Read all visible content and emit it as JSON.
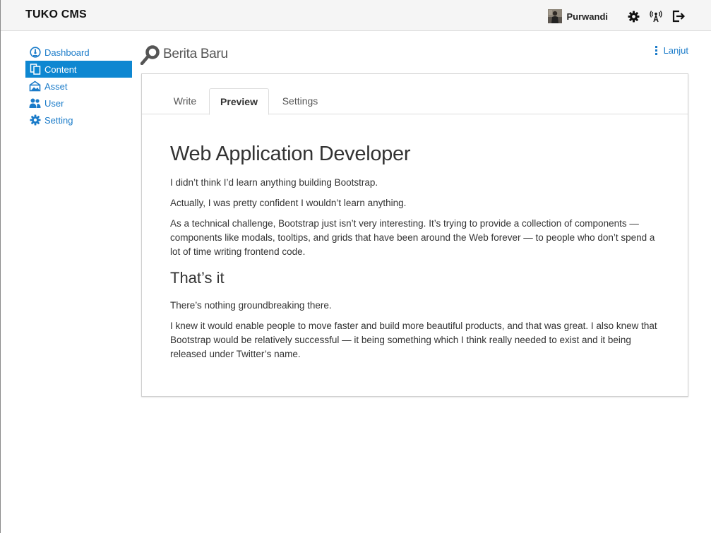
{
  "navbar": {
    "brand": "TUKO CMS",
    "user_name": "Purwandi",
    "icons": [
      "avatar",
      "gear-icon",
      "broadcast-icon",
      "logout-icon"
    ]
  },
  "sidebar": {
    "items": [
      {
        "label": "Dashboard",
        "icon": "dashboard-icon",
        "active": false
      },
      {
        "label": "Content",
        "icon": "content-icon",
        "active": true
      },
      {
        "label": "Asset",
        "icon": "asset-icon",
        "active": false
      },
      {
        "label": "User",
        "icon": "user-icon",
        "active": false
      },
      {
        "label": "Setting",
        "icon": "gear-icon",
        "active": false
      }
    ]
  },
  "page": {
    "title": "Berita Baru",
    "action_label": "Lanjut"
  },
  "tabs": [
    {
      "label": "Write",
      "active": false
    },
    {
      "label": "Preview",
      "active": true
    },
    {
      "label": "Settings",
      "active": false
    }
  ],
  "article": {
    "heading": "Web Application Developer",
    "para1": "I didn’t think I’d learn anything building Bootstrap.",
    "para2": "Actually, I was pretty confident I wouldn’t learn anything.",
    "para3": "As a technical challenge, Bootstrap just isn’t very interesting. It’s trying to provide a collection of components — components like modals, tooltips, and grids that have been around the Web forever — to people who don’t spend a lot of time writing frontend code.",
    "subheading": "That’s it",
    "para4": "There’s nothing groundbreaking there.",
    "para5": "I knew it would enable people to move faster and build more beautiful products, and that was great. I also knew that Bootstrap would be relatively successful — it being something which I think really needed to exist and it being released under Twitter’s name."
  },
  "colors": {
    "accent": "#0e87d1",
    "link": "#1a7bc9",
    "navbar_bg": "#f5f5f5"
  }
}
